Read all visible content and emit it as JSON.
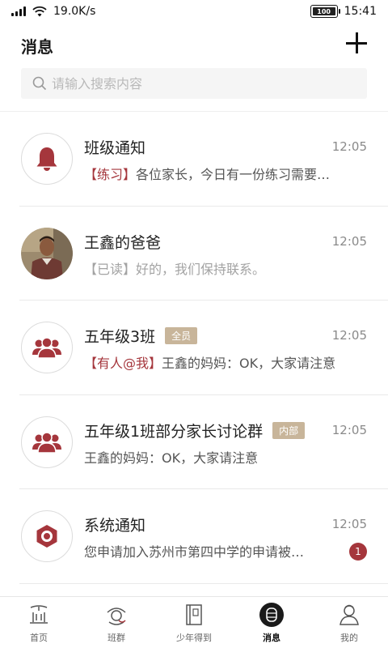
{
  "status_bar": {
    "speed": "19.0K/s",
    "battery": "100",
    "time": "15:41"
  },
  "header": {
    "title": "消息"
  },
  "search": {
    "placeholder": "请输入搜索内容"
  },
  "colors": {
    "accent": "#a5363c",
    "badge": "#c8b59a",
    "muted": "#a3a3a3"
  },
  "messages": [
    {
      "name": "班级通知",
      "time": "12:05",
      "tag": "【练习】",
      "text": "各位家长，今日有一份练习需要…",
      "icon": "bell-icon"
    },
    {
      "name": "王鑫的爸爸",
      "time": "12:05",
      "tag": "【已读】",
      "text": "好的，我们保持联系。",
      "icon": "user-photo"
    },
    {
      "name": "五年级3班",
      "badge": "全员",
      "time": "12:05",
      "tag": "【有人@我】",
      "text": "王鑫的妈妈：OK，大家请注意",
      "icon": "group-icon"
    },
    {
      "name": "五年级1班部分家长讨论群",
      "badge": "内部",
      "time": "12:05",
      "text": "王鑫的妈妈：OK，大家请注意",
      "icon": "group-icon"
    },
    {
      "name": "系统通知",
      "time": "12:05",
      "text": "您申请加入苏州市第四中学的申请被…",
      "unread": "1",
      "icon": "system-icon"
    }
  ],
  "tabs": [
    {
      "label": "首页",
      "icon": "home-icon"
    },
    {
      "label": "班群",
      "icon": "class-group-icon"
    },
    {
      "label": "少年得到",
      "icon": "book-icon"
    },
    {
      "label": "消息",
      "icon": "message-icon",
      "active": true
    },
    {
      "label": "我的",
      "icon": "profile-icon"
    }
  ]
}
